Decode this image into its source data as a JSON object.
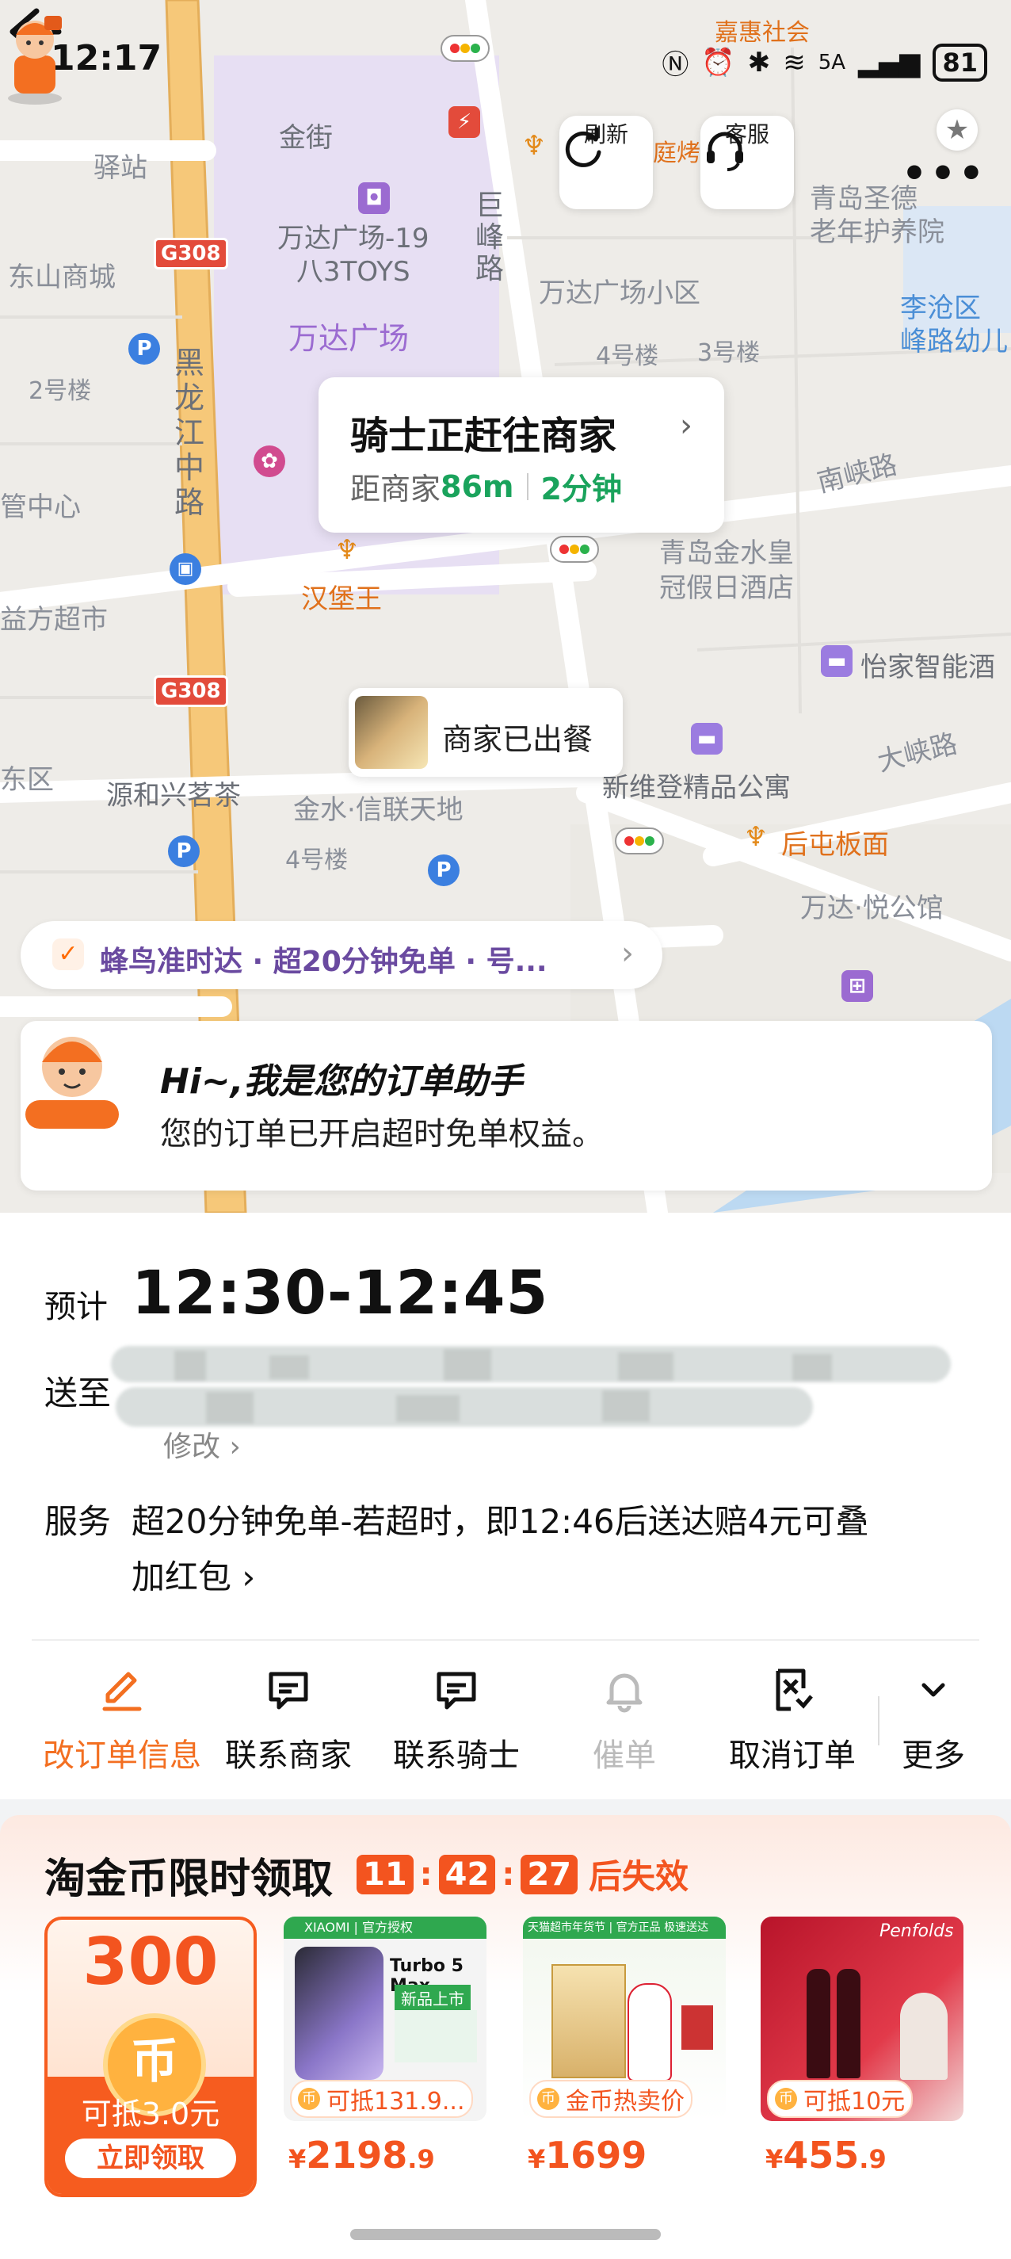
{
  "status_bar": {
    "time": "12:17",
    "battery": "81",
    "network": "5A"
  },
  "map": {
    "labels": {
      "jinjie": "金街",
      "wanda_plaza": "万达广场",
      "wanda_19": "万达广场-19\n八3TOYS",
      "julu": "巨峰路",
      "wanda_xiaoqu": "万达广场小区",
      "b4": "4号楼",
      "b3": "3号楼",
      "b2": "2号楼",
      "heilongjiang": "黑龙江中路",
      "dongshan": "东山商城",
      "qingdao_shengde": "青岛圣德\n老年护养院",
      "licang": "李沧区\n峰路幼儿",
      "nanxia": "南峡路",
      "jinshui_hotel": "青岛金水皇\n冠假日酒店",
      "hamburger": "汉堡王",
      "yijia": "怡家智能酒",
      "daxia": "大峡路",
      "xinwei": "新维登精品公寓",
      "houtun": "后屯板面",
      "jinshui_xinlian": "金水·信联天地",
      "yuanhexing": "源和兴茗茶",
      "wanda_yue": "万达·悦公馆",
      "b4b": "4号楼",
      "guanzhongxin": "管中心",
      "yifang": "益方超市",
      "dongqu": "东区",
      "jiahui": "嘉惠社会",
      "g308a": "G308",
      "g308b": "G308",
      "tingkao": "庭烤",
      "zhan": "驿站"
    },
    "buttons": {
      "refresh": "刷新",
      "service": "客服"
    },
    "rider_card": {
      "title": "骑士正赶往商家",
      "distance_label": "距商家",
      "distance": "86m",
      "time": "2分钟"
    },
    "merchant_status": "商家已出餐",
    "ontime_banner": "蜂鸟准时达 · 超20分钟免单 · 号...",
    "assistant": {
      "avatar_label": "订单助手",
      "greeting": "Hi~,我是您的订单助手",
      "message": "您的订单已开启超时免单权益。"
    }
  },
  "order": {
    "eta_label": "预计",
    "eta": "12:30-12:45",
    "address_label": "送至",
    "modify": "修改 ›",
    "service_label": "服务",
    "service_line1": "超20分钟免单-若超时，即12:46后送达赔4元可叠",
    "service_line2": "加红包 ›",
    "actions": [
      {
        "label": "改订单信息",
        "icon": "edit-icon"
      },
      {
        "label": "联系商家",
        "icon": "chat-icon"
      },
      {
        "label": "联系骑士",
        "icon": "chat-icon"
      },
      {
        "label": "催单",
        "icon": "bell-icon"
      },
      {
        "label": "取消订单",
        "icon": "cancel-doc-icon"
      },
      {
        "label": "更多",
        "icon": "chevron-down-icon"
      }
    ]
  },
  "promo": {
    "title": "淘金币限时领取",
    "countdown": {
      "h": "11",
      "m": "42",
      "s": "27",
      "suffix": "后失效"
    },
    "coin_card": {
      "amount": "300",
      "coin_glyph": "币",
      "deduct": "可抵3.0元",
      "button": "立即领取"
    },
    "products": [
      {
        "tag": "可抵131.9...",
        "price_int": "2198",
        "price_dec": ".9",
        "brand": "XIAOMI | 官方授权",
        "headline": "Turbo 5 Max",
        "badge": "新品上市"
      },
      {
        "tag": "金币热卖价",
        "price_int": "1699",
        "price_dec": "",
        "brand": "天猫超市年货节 | 官方正品 极速送达"
      },
      {
        "tag": "可抵10元",
        "price_int": "455",
        "price_dec": ".9",
        "brand": "Penfolds"
      }
    ],
    "currency": "¥"
  },
  "colors": {
    "accent": "#f36f21",
    "green": "#1aa35c",
    "purple": "#6a4aa0",
    "promo_red": "#f3541f"
  }
}
